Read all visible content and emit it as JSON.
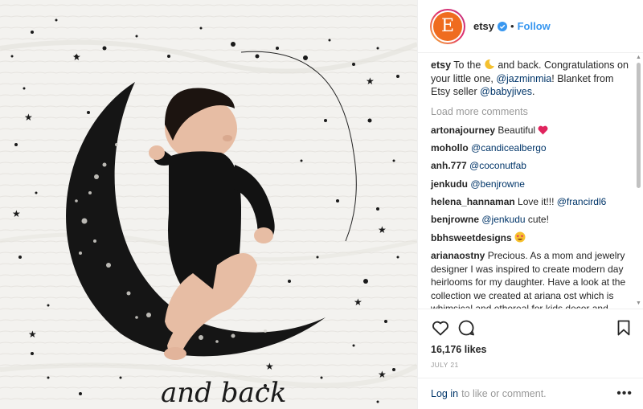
{
  "header": {
    "avatar_letter": "E",
    "username": "etsy",
    "separator": "•",
    "follow_label": "Follow"
  },
  "photo": {
    "handwriting": "and back"
  },
  "caption": {
    "username": "etsy",
    "part1": "To the",
    "moon_icon": "crescent-moon-emoji",
    "part2": "and back. Congratulations on your little one,",
    "mention1": "@jazminmia",
    "part3": "! Blanket from Etsy seller",
    "mention2": "@babyjives",
    "part4": "."
  },
  "load_more": "Load more comments",
  "comments": [
    {
      "user": "artonajourney",
      "text": "Beautiful",
      "emoji": "red-heart-emoji"
    },
    {
      "user": "mohollo",
      "mention": "@candicealbergo"
    },
    {
      "user": "anh.777",
      "mention": "@coconutfab"
    },
    {
      "user": "jenkudu",
      "mention": "@benjrowne"
    },
    {
      "user": "helena_hannaman",
      "text": "Love it!!!",
      "mention": "@francirdl6"
    },
    {
      "user": "benjrowne",
      "mention": "@jenkudu",
      "text_after": "cute!"
    },
    {
      "user": "bbhsweetdesigns",
      "emoji": "star-struck-emoji"
    },
    {
      "user": "arianaostny",
      "text": "Precious. As a mom and jewelry designer I was inspired to create modern day heirlooms for my daughter. Have a look at the collection we created at ariana ost which is whimsical and ethereal for kids decor and accessories."
    }
  ],
  "likes": "16,176 likes",
  "date": "JULY 21",
  "footer": {
    "login_label": "Log in",
    "rest": "to like or comment.",
    "more_label": "•••"
  },
  "colors": {
    "link_blue": "#3897f0",
    "mention_blue": "#003569",
    "etsy_orange": "#ef6c1f",
    "heart_red": "#ed4956",
    "muted_gray": "#999999"
  }
}
